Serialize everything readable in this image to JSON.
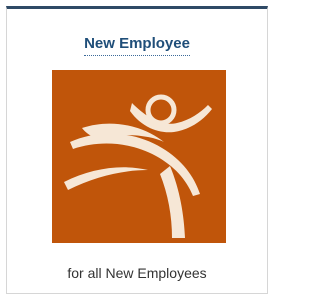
{
  "card": {
    "title": "New Employee",
    "subtitle": "for all New Employees",
    "icon": "dancing-figure-logo-icon",
    "colors": {
      "title": "#1f4e79",
      "top_border": "#2f4a66",
      "tile_background": "#c0550a",
      "figure": "#f6e7d6"
    }
  }
}
